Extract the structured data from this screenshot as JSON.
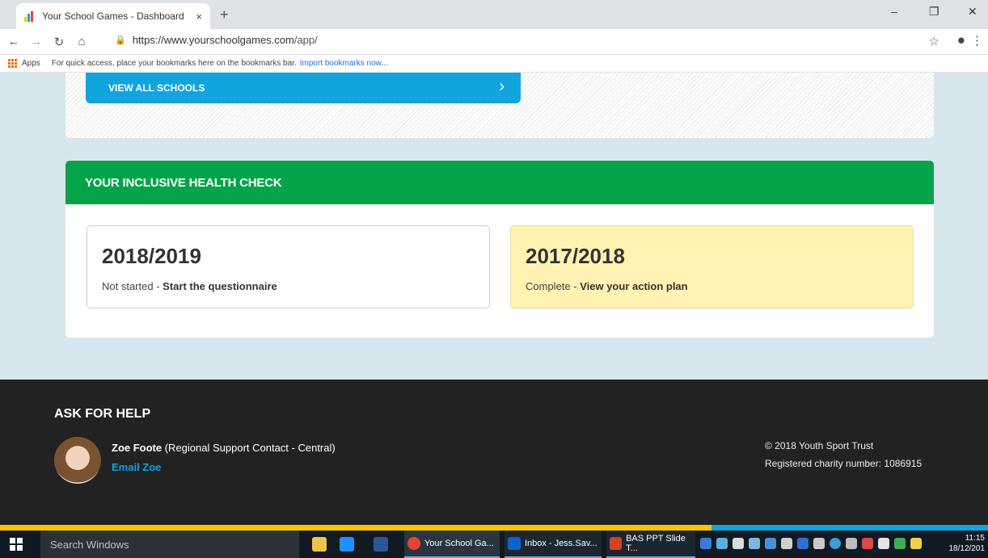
{
  "browser": {
    "tab_title": "Your School Games - Dashboard",
    "tab_close": "×",
    "new_tab": "+",
    "url_host": "https://www.yourschoolgames.com",
    "url_path": "/app/",
    "bookmarks_apps": "Apps",
    "bookmarks_hint": "For quick access, place your bookmarks here on the bookmarks bar.",
    "bookmarks_import": "Import bookmarks now..."
  },
  "schools": {
    "view_all_label": "VIEW ALL SCHOOLS"
  },
  "health_check": {
    "title": "YOUR INCLUSIVE HEALTH CHECK",
    "cards": [
      {
        "year": "2018/2019",
        "status": "Not started",
        "sep": " - ",
        "action": "Start the questionnaire"
      },
      {
        "year": "2017/2018",
        "status": "Complete",
        "sep": " - ",
        "action": "View your action plan"
      }
    ]
  },
  "footer": {
    "help_title": "ASK FOR HELP",
    "contact_name": "Zoe Foote",
    "contact_role": " (Regional Support Contact - Central)",
    "email_label": "Email Zoe",
    "copyright": "© 2018 Youth Sport Trust",
    "charity": "Registered charity number: 1086915"
  },
  "taskbar": {
    "search_placeholder": "Search Windows",
    "apps": [
      {
        "label": "Your School Ga...",
        "color": "#e94235"
      },
      {
        "label": "Inbox - Jess.Sav...",
        "color": "#0a64c8"
      },
      {
        "label": "BAS PPT Slide T...",
        "color": "#d04423"
      }
    ],
    "time": "11:15",
    "date": "18/12/201"
  },
  "colors": {
    "accent_blue": "#12a4df",
    "header_green": "#05a44a",
    "complete_yellow": "#fff3b3",
    "footer_dark": "#222222"
  }
}
